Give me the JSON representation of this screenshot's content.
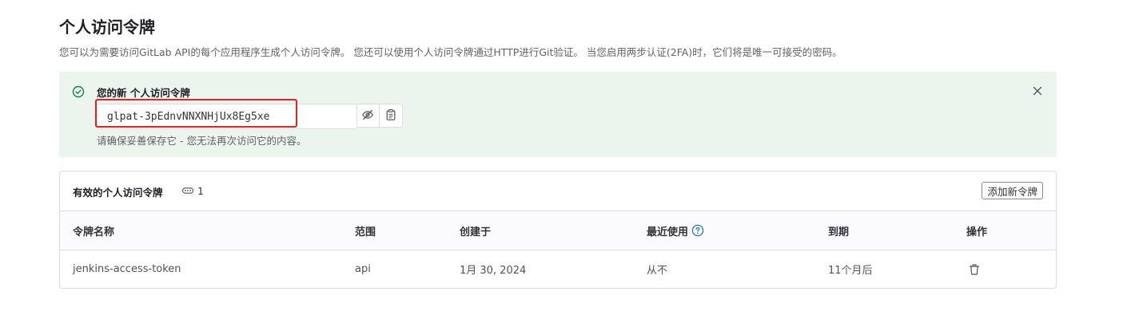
{
  "page": {
    "title": "个人访问令牌",
    "description": "您可以为需要访问GitLab API的每个应用程序生成个人访问令牌。 您还可以使用个人访问令牌通过HTTP进行Git验证。 当您启用两步认证(2FA)时，它们将是唯一可接受的密码。"
  },
  "alert": {
    "title": "您的新 个人访问令牌",
    "token_value": "glpat-3pEdnvNNXNHjUx8Eg5xe",
    "hint": "请确保妥善保存它 - 您无法再次访问它的内容。",
    "icons": {
      "status": "check-circle-icon",
      "close": "close-icon",
      "visibility": "eye-slash-icon",
      "copy": "clipboard-icon"
    },
    "colors": {
      "background": "#ecf4ee",
      "success": "#108548",
      "highlight": "#e02424"
    }
  },
  "tokens": {
    "title": "有效的个人访问令牌",
    "count": "1",
    "add_button": "添加新令牌",
    "columns": [
      "令牌名称",
      "范围",
      "创建于",
      "最近使用",
      "到期",
      "操作"
    ],
    "rows": [
      {
        "name": "jenkins-access-token",
        "scope": "api",
        "created": "1月 30, 2024",
        "last_used": "从不",
        "expires": "11个月后",
        "action_icon": "trash-icon"
      }
    ]
  }
}
